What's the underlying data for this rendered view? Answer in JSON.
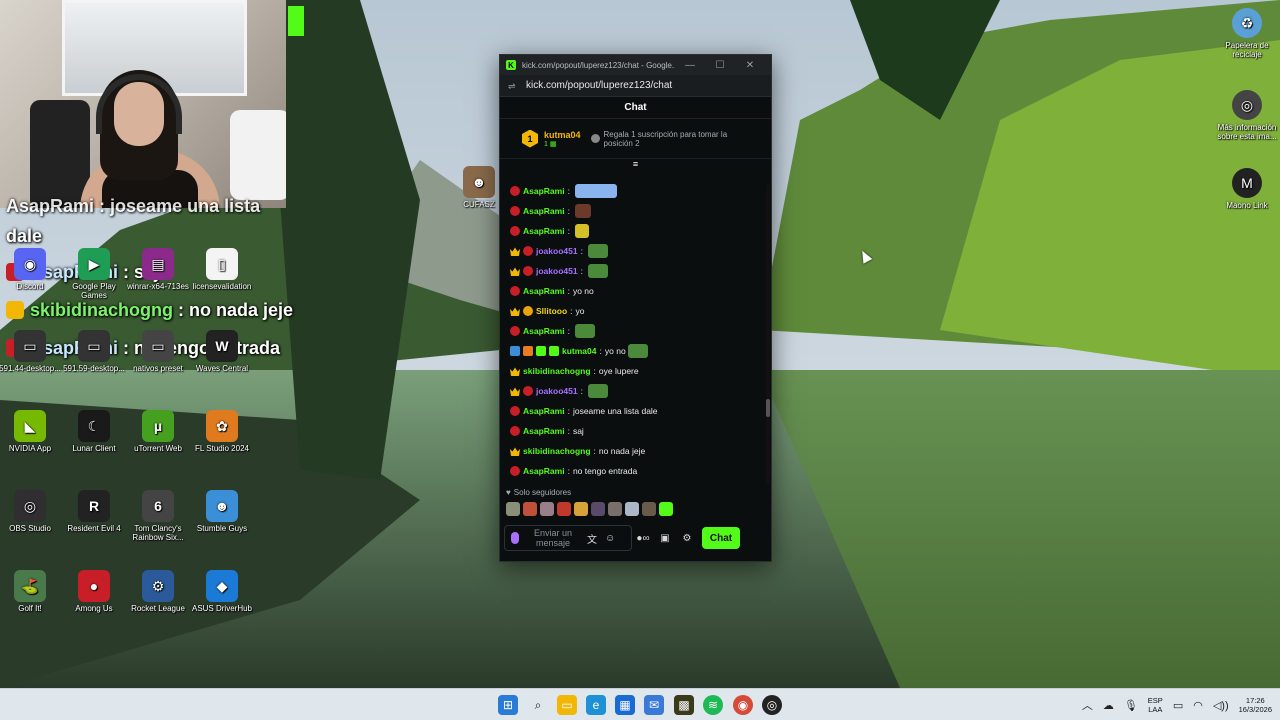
{
  "popup": {
    "title": "kick.com/popout/luperez123/chat - Google...",
    "url": "kick.com/popout/luperez123/chat",
    "header": "Chat",
    "pinned": {
      "rank": "1",
      "username": "kutma04",
      "sub_count": "1",
      "promo": "Regala 1 suscripción para tomar la posición 2"
    },
    "messages": [
      {
        "badges": [
          "b-red"
        ],
        "user": "AsapRami",
        "user_class": "u-green",
        "text": "",
        "emote": "em-wide"
      },
      {
        "badges": [
          "b-red"
        ],
        "user": "AsapRami",
        "user_class": "u-green",
        "text": "",
        "emote": "em-pepe"
      },
      {
        "badges": [
          "b-red"
        ],
        "user": "AsapRami",
        "user_class": "u-green",
        "text": "",
        "emote": "em-yellow"
      },
      {
        "badges": [
          "b-crown",
          "b-red"
        ],
        "user": "joakoo451",
        "user_class": "u-purple",
        "text": "",
        "emote": "em-frog"
      },
      {
        "badges": [
          "b-crown",
          "b-red"
        ],
        "user": "joakoo451",
        "user_class": "u-purple",
        "text": "",
        "emote": "em-frog"
      },
      {
        "badges": [
          "b-red"
        ],
        "user": "AsapRami",
        "user_class": "u-green",
        "text": "yo no",
        "emote": ""
      },
      {
        "badges": [
          "b-crown",
          "b-gold"
        ],
        "user": "Sllitooo",
        "user_class": "u-gold",
        "text": "yo",
        "emote": ""
      },
      {
        "badges": [
          "b-red"
        ],
        "user": "AsapRami",
        "user_class": "u-green",
        "text": "",
        "emote": "em-frog"
      },
      {
        "badges": [
          "b-blue",
          "b-orange",
          "b-green",
          "b-green"
        ],
        "user": "kutma04",
        "user_class": "u-green",
        "text": "yo no",
        "emote": "em-frog"
      },
      {
        "badges": [
          "b-crown"
        ],
        "user": "skibidinachogng",
        "user_class": "u-green",
        "text": "oye lupere",
        "emote": ""
      },
      {
        "badges": [
          "b-crown",
          "b-red"
        ],
        "user": "joakoo451",
        "user_class": "u-purple",
        "text": "",
        "emote": "em-frog"
      },
      {
        "badges": [
          "b-red"
        ],
        "user": "AsapRami",
        "user_class": "u-green",
        "text": "joseame una lista dale",
        "emote": ""
      },
      {
        "badges": [
          "b-red"
        ],
        "user": "AsapRami",
        "user_class": "u-green",
        "text": "saj",
        "emote": ""
      },
      {
        "badges": [
          "b-crown"
        ],
        "user": "skibidinachogng",
        "user_class": "u-green",
        "text": "no nada jeje",
        "emote": ""
      },
      {
        "badges": [
          "b-red"
        ],
        "user": "AsapRami",
        "user_class": "u-green",
        "text": "no tengo entrada",
        "emote": ""
      }
    ],
    "followers_only": "Solo seguidores",
    "input_placeholder": "Enviar un mensaje",
    "send_label": "Chat",
    "avatar_colors": [
      "#8a8f7a",
      "#c0503a",
      "#9a7f8a",
      "#c0392b",
      "#d8a23a",
      "#5a4a6a",
      "#7a6f6a",
      "#aab8c8",
      "#6a5a4a",
      "#53fc18"
    ]
  },
  "overlay_chat": {
    "line0_a": "AsapRami : josea",
    "line0_b": "me una lista",
    "line1": "dale",
    "line2_user": "AsapRami",
    "line2_text": " : saj",
    "line3_user": "skibidinachogng",
    "line3_text": " : no nada jeje",
    "line4_user": "AsapRami",
    "line4_text": " : no tengo entrada"
  },
  "desktop_icons": [
    {
      "label": "Discord",
      "color": "#5865f2",
      "glyph": "◉"
    },
    {
      "label": "Google Play Games",
      "color": "#1f9d55",
      "glyph": "▶"
    },
    {
      "label": "winrar-x64-713es",
      "color": "#8b2a8b",
      "glyph": "▤"
    },
    {
      "label": "licensevalidation",
      "color": "#f4f4f4",
      "glyph": "▯"
    },
    {
      "label": "591.44-desktop...",
      "color": "#333",
      "glyph": "▭"
    },
    {
      "label": "591.59-desktop...",
      "color": "#333",
      "glyph": "▭"
    },
    {
      "label": "nativos preset",
      "color": "#444",
      "glyph": "▭"
    },
    {
      "label": "Waves Central",
      "color": "#222",
      "glyph": "W"
    },
    {
      "label": "NVIDIA App",
      "color": "#76b900",
      "glyph": "◣"
    },
    {
      "label": "Lunar Client",
      "color": "#1a1a1a",
      "glyph": "☾"
    },
    {
      "label": "uTorrent Web",
      "color": "#46a01f",
      "glyph": "µ"
    },
    {
      "label": "FL Studio 2024",
      "color": "#e07a1f",
      "glyph": "✿"
    },
    {
      "label": "OBS Studio",
      "color": "#302e31",
      "glyph": "◎"
    },
    {
      "label": "Resident Evil 4",
      "color": "#222",
      "glyph": "R"
    },
    {
      "label": "Tom Clancy's Rainbow Six...",
      "color": "#444",
      "glyph": "6"
    },
    {
      "label": "Stumble Guys",
      "color": "#3a8fd6",
      "glyph": "☻"
    },
    {
      "label": "Golf It!",
      "color": "#4a7a4a",
      "glyph": "⛳"
    },
    {
      "label": "Among Us",
      "color": "#c81e28",
      "glyph": "●"
    },
    {
      "label": "Rocket League",
      "color": "#2a5a9a",
      "glyph": "⚙"
    },
    {
      "label": "ASUS DriverHub",
      "color": "#1a7ad6",
      "glyph": "◆"
    }
  ],
  "desktop_mid_icon": {
    "label": "CUFASZ"
  },
  "right_icons": [
    {
      "label": "Papelera de reciclaje",
      "color": "#5aa0d6",
      "glyph": "♻"
    },
    {
      "label": "Más información sobre esta ima...",
      "color": "#444",
      "glyph": "◎"
    },
    {
      "label": "Maono Link",
      "color": "#222",
      "glyph": "M"
    }
  ],
  "taskbar": {
    "lang_top": "ESP",
    "lang_bottom": "LAA",
    "time": "17:26",
    "date": "16/3/2026"
  }
}
